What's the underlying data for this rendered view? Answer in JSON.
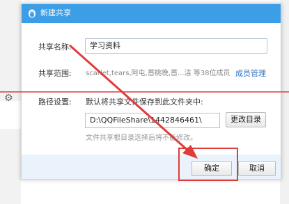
{
  "dialog": {
    "title": "新建共享",
    "share_name_label": "共享名称:",
    "share_name_value": "学习资料",
    "share_scope_label": "共享范围:",
    "members_text": "scarlet,tears,阿屯,蔷桃晚,蔷...洁 等38位成员",
    "member_manage_link": "成员管理",
    "path_label": "路径设置:",
    "path_hint": "默认将共享文件保存到此文件夹中:",
    "path_value": "D:\\QQFileShare\\1442846461\\",
    "change_dir_button": "更改目录",
    "path_subhint": "文件共享根目录选择后将不能修改。",
    "ok_button": "确定",
    "cancel_button": "取消"
  },
  "colors": {
    "titlebar": "#3d9ee8",
    "annotation_red": "#e03b3b",
    "link_blue": "#2c74c5"
  }
}
